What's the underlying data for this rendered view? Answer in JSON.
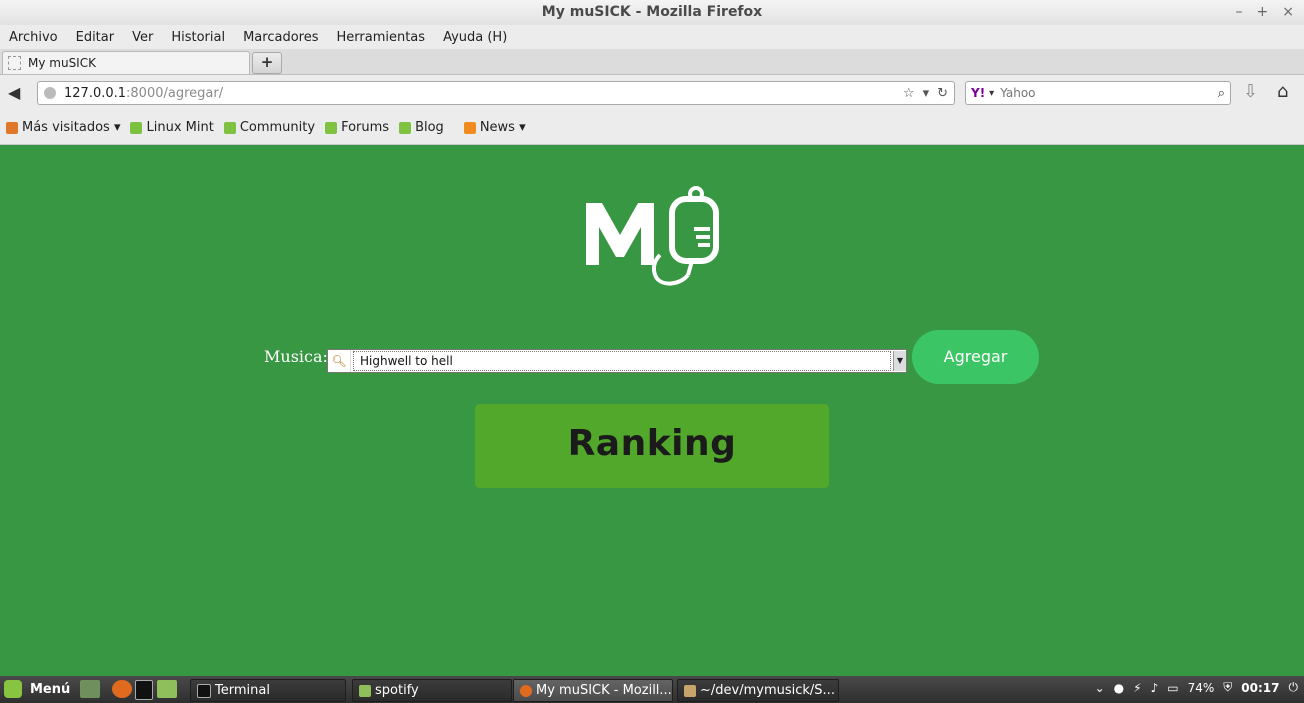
{
  "window": {
    "title": "My muSICK - Mozilla Firefox",
    "controls": [
      "–",
      "+",
      "×"
    ]
  },
  "menu": [
    "Archivo",
    "Editar",
    "Ver",
    "Historial",
    "Marcadores",
    "Herramientas",
    "Ayuda (H)"
  ],
  "tab": {
    "title": "My muSICK",
    "new_tab": "+"
  },
  "nav": {
    "url_host": "127.0.0.1",
    "url_rest": ":8000/agregar/",
    "search_engine": "Y!",
    "search_placeholder": "Yahoo"
  },
  "bookmarks": [
    {
      "label": "Más visitados ▾",
      "icon": "most-visited-icon"
    },
    {
      "label": "Linux Mint",
      "icon": "mint-icon"
    },
    {
      "label": "Community",
      "icon": "mint-icon"
    },
    {
      "label": "Forums",
      "icon": "mint-icon"
    },
    {
      "label": "Blog",
      "icon": "mint-icon"
    },
    {
      "label": "News ▾",
      "icon": "rss-icon"
    }
  ],
  "page": {
    "field_label": "Musica:",
    "field_value": "Highwell to hell",
    "add_button": "Agregar",
    "ranking_button": "Ranking",
    "background": "#389742"
  },
  "taskbar": {
    "menu_label": "Menú",
    "tasks": [
      {
        "label": "Terminal",
        "active": false
      },
      {
        "label": "spotify",
        "active": false
      },
      {
        "label": "My muSICK - Mozill...",
        "active": true
      },
      {
        "label": "~/dev/mymusick/S...",
        "active": false
      }
    ],
    "battery": "74%",
    "clock": "00:17"
  }
}
